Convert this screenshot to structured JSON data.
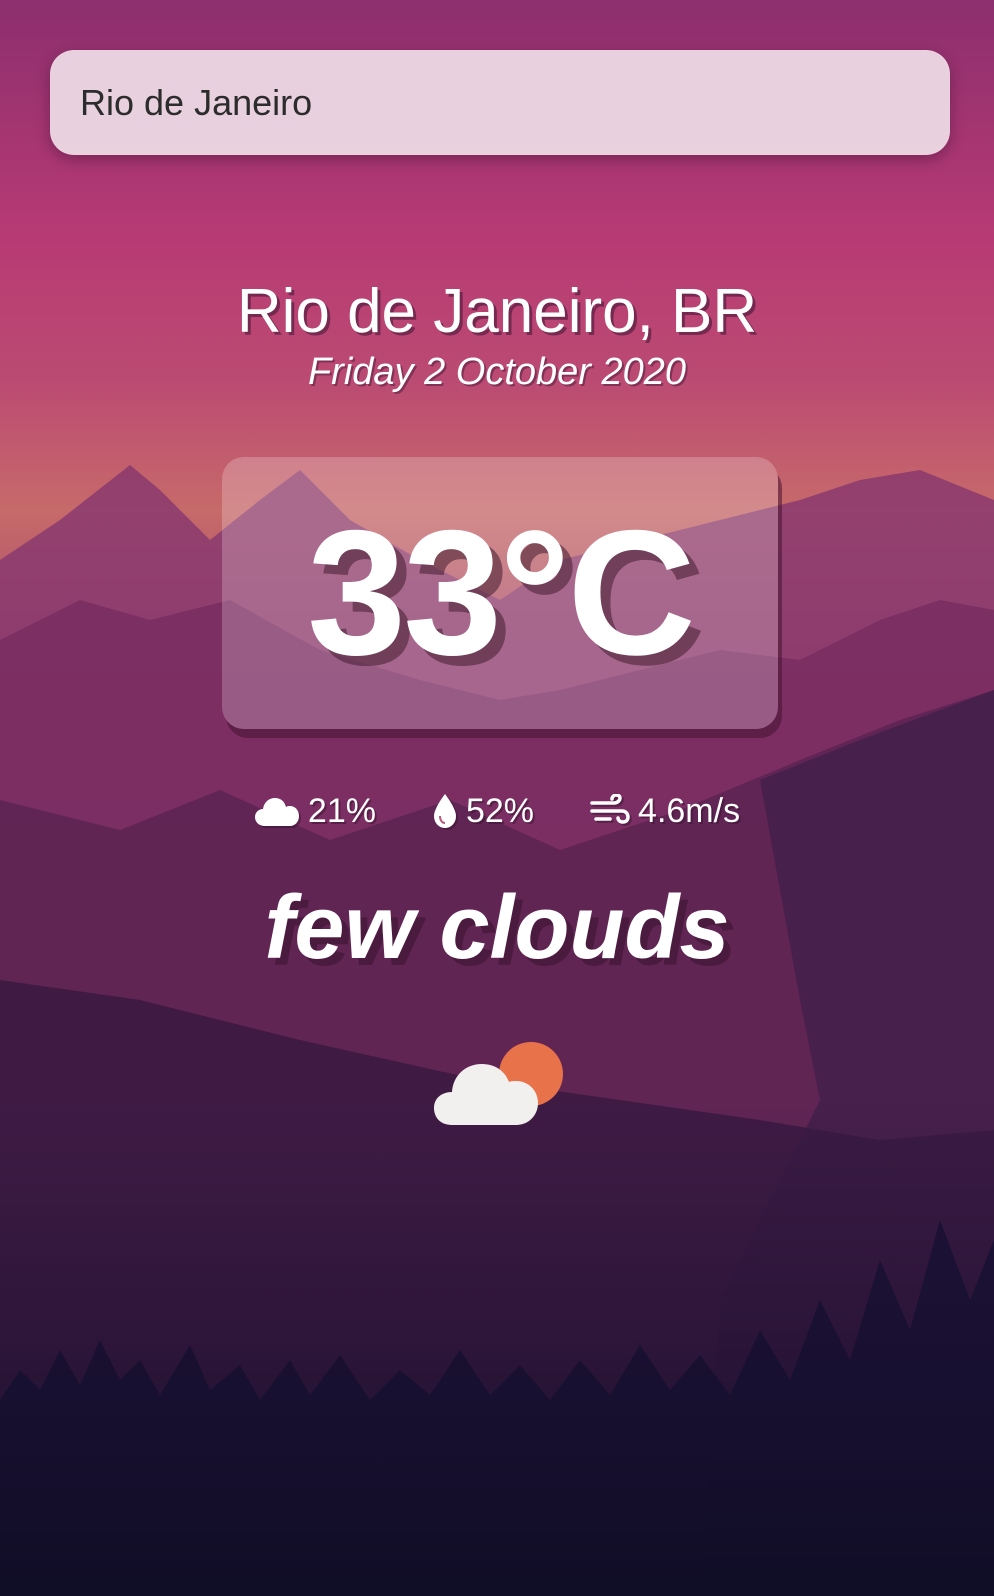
{
  "search": {
    "value": "Rio de Janeiro",
    "placeholder": ""
  },
  "location": {
    "city_country": "Rio de Janeiro, BR",
    "date": "Friday 2 October 2020"
  },
  "weather": {
    "temperature": "33°C",
    "cloudiness": "21%",
    "humidity": "52%",
    "wind_speed": "4.6m/s",
    "description": "few clouds",
    "condition_icon": "few-clouds-icon"
  },
  "colors": {
    "sky_top": "#8c2f6e",
    "sky_mid": "#b83a74",
    "horizon": "#c76a6a",
    "ground_dark": "#120e2a",
    "sun": "#e8724a",
    "cloud": "#f2f0ee"
  }
}
